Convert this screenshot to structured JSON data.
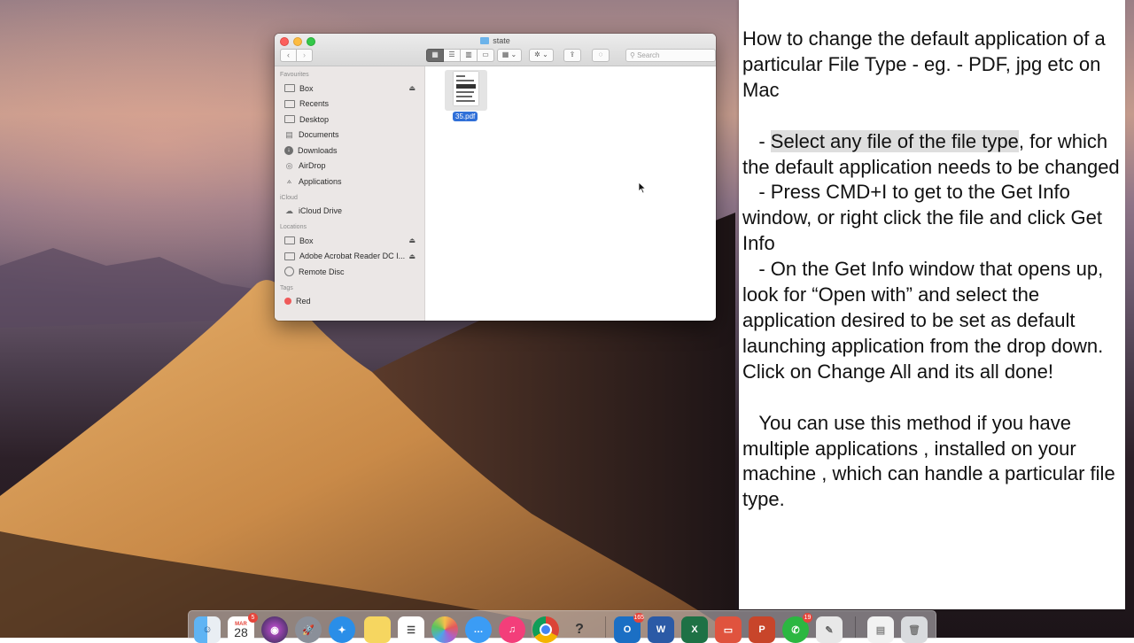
{
  "finder": {
    "title": "state",
    "nav": {
      "back": "‹",
      "forward": "›"
    },
    "view_buttons": [
      "icon-view",
      "list-view",
      "column-view",
      "gallery-view"
    ],
    "search_placeholder": "Search",
    "sidebar": {
      "sections": [
        {
          "heading": "Favourites",
          "items": [
            {
              "label": "Box",
              "icon": "folder-icon",
              "eject": true
            },
            {
              "label": "Recents",
              "icon": "recents-icon"
            },
            {
              "label": "Desktop",
              "icon": "desktop-icon"
            },
            {
              "label": "Documents",
              "icon": "documents-icon"
            },
            {
              "label": "Downloads",
              "icon": "downloads-icon"
            },
            {
              "label": "AirDrop",
              "icon": "airdrop-icon"
            },
            {
              "label": "Applications",
              "icon": "applications-icon"
            }
          ]
        },
        {
          "heading": "iCloud",
          "items": [
            {
              "label": "iCloud Drive",
              "icon": "cloud-icon"
            }
          ]
        },
        {
          "heading": "Locations",
          "items": [
            {
              "label": "Box",
              "icon": "folder-icon",
              "eject": true
            },
            {
              "label": "Adobe Acrobat Reader DC I...",
              "icon": "drive-icon",
              "eject": true
            },
            {
              "label": "Remote Disc",
              "icon": "disc-icon"
            }
          ]
        },
        {
          "heading": "Tags",
          "items": [
            {
              "label": "Red",
              "icon": "red-tag-icon"
            }
          ]
        }
      ]
    },
    "file": {
      "name": "35.pdf"
    }
  },
  "notes": {
    "title_line": "How to change the default application of a particular File Type - eg. - PDF, jpg etc on Mac",
    "step1_highlight": "Select any file of the file type",
    "step1_rest": ", for which the default application needs to be changed",
    "step2": "- Press CMD+I to get to the Get Info window, or right click the file and click Get Info",
    "step3": "- On the Get Info window that opens up, look for “Open with” and select the application desired to be set as default launching application from the drop down. Click on Change All and its all done!",
    "footer": "You can use this method if you have multiple applications , installed on your machine , which can handle a particular file type."
  },
  "dock": {
    "calendar_month": "MAR",
    "calendar_day": "28",
    "calendar_badge": "5",
    "outlook_badge": "165",
    "whatsapp_badge": "19",
    "icons": [
      "finder-icon",
      "calendar-icon",
      "siri-icon",
      "launchpad-icon",
      "safari-icon",
      "notes-icon",
      "reminders-icon",
      "photos-icon",
      "messages-icon",
      "itunes-icon",
      "chrome-icon",
      "fish-icon",
      "outlook-icon",
      "word-icon",
      "excel-icon",
      "remote-desktop-icon",
      "powerpoint-icon",
      "whatsapp-icon",
      "preview-icon",
      "documents-stack-icon",
      "trash-icon"
    ],
    "colors": {
      "outlook": "#1b6fc4",
      "word": "#2b5aa6",
      "excel": "#1e7145",
      "powerpoint": "#c8452a",
      "whatsapp": "#2bb741",
      "chrome": "#db4437"
    }
  }
}
